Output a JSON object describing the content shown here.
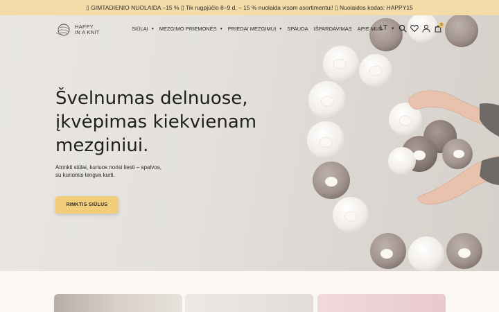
{
  "promo": {
    "text": "▯ GIMTADIENIO NUOLAIDA –15 % ▯ Tik rugpjūčio 8–9 d. – 15 % nuolaida visam asortimentui! ▯ Nuolaidos kodas: HAPPY15"
  },
  "logo": {
    "line1": "HAPPY",
    "line2": "IN A KNIT"
  },
  "nav": {
    "items": [
      {
        "label": "SIŪLAI",
        "dropdown": true
      },
      {
        "label": "MEZGIMO PRIEMONĖS",
        "dropdown": true
      },
      {
        "label": "PRIEDAI MEZGIMUI",
        "dropdown": true
      },
      {
        "label": "SPAUDA",
        "dropdown": false
      },
      {
        "label": "IŠPARDAVIMAS",
        "dropdown": false
      },
      {
        "label": "APIE MUS",
        "dropdown": false
      }
    ],
    "caret": "▾"
  },
  "language": {
    "current": "LT",
    "caret": "▾"
  },
  "header_icons": [
    "search-icon",
    "heart-icon",
    "user-icon",
    "cart-icon"
  ],
  "cart": {
    "count": "0"
  },
  "hero": {
    "headline_line1": "Švelnumas delnuose,",
    "headline_line2": "įkvėpimas kiekvienam",
    "headline_line3": "mezginiui.",
    "subline_line1": "Atrinkti siūlai, kuriuos norisi liesti – spalvos,",
    "subline_line2": "su kuriomis lengva kurti.",
    "cta_label": "RINKTIS SIŪLUS"
  },
  "colors": {
    "promo_bg": "#f4dca8",
    "cta_bg": "#f2cd7a",
    "page_bg": "#fbf7f2",
    "yarn_cream": "#f6f3ef",
    "yarn_taupe": "#a59891",
    "yarn_dark": "#8c7f78"
  }
}
